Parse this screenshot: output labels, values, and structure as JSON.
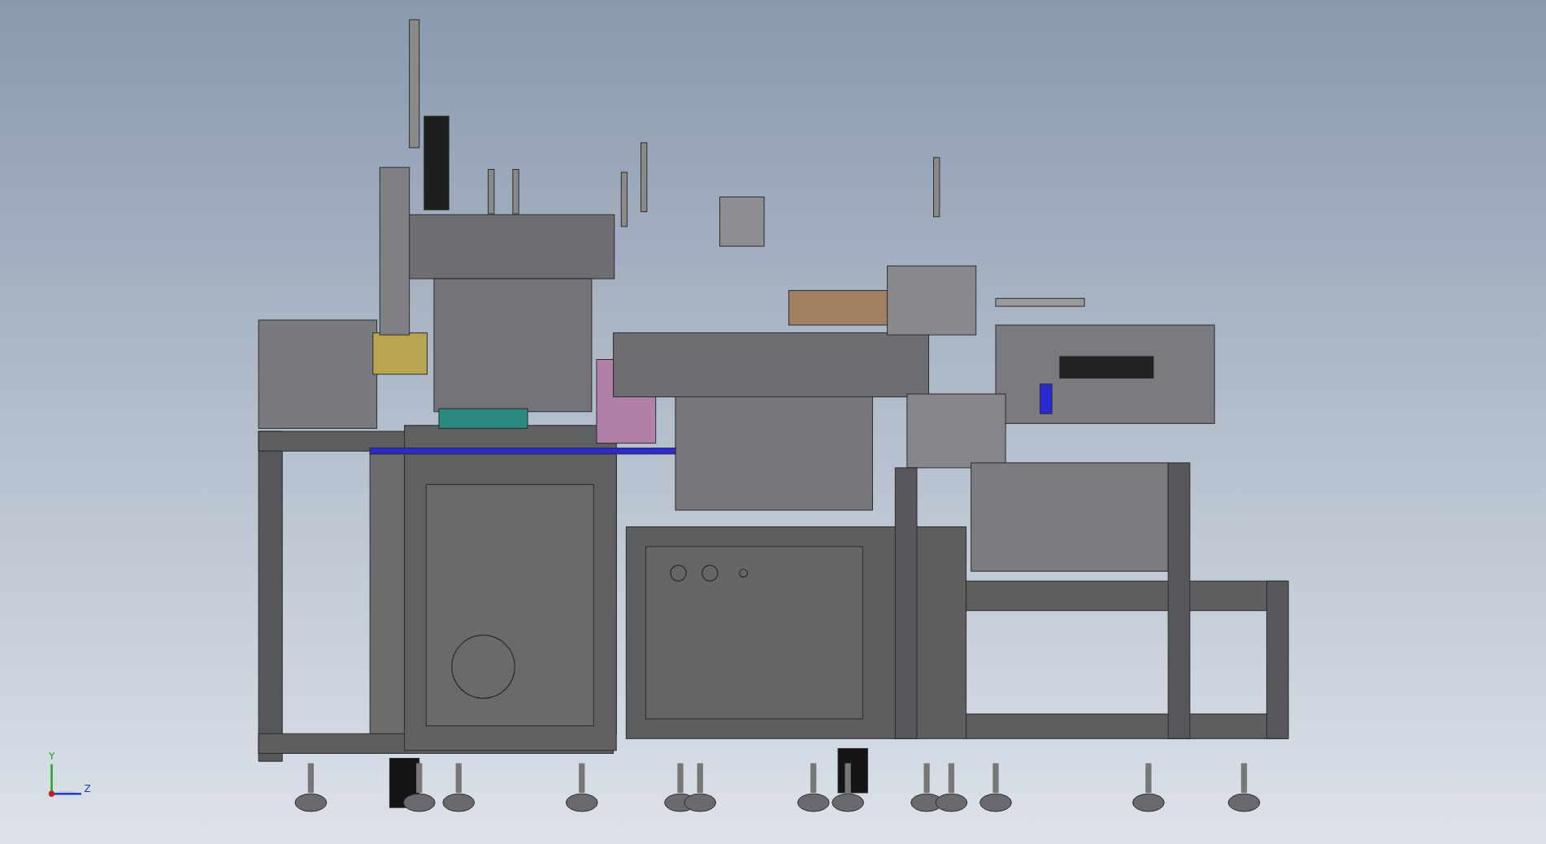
{
  "viewport": {
    "triad": {
      "labels": [
        "Y",
        "Z"
      ]
    }
  }
}
